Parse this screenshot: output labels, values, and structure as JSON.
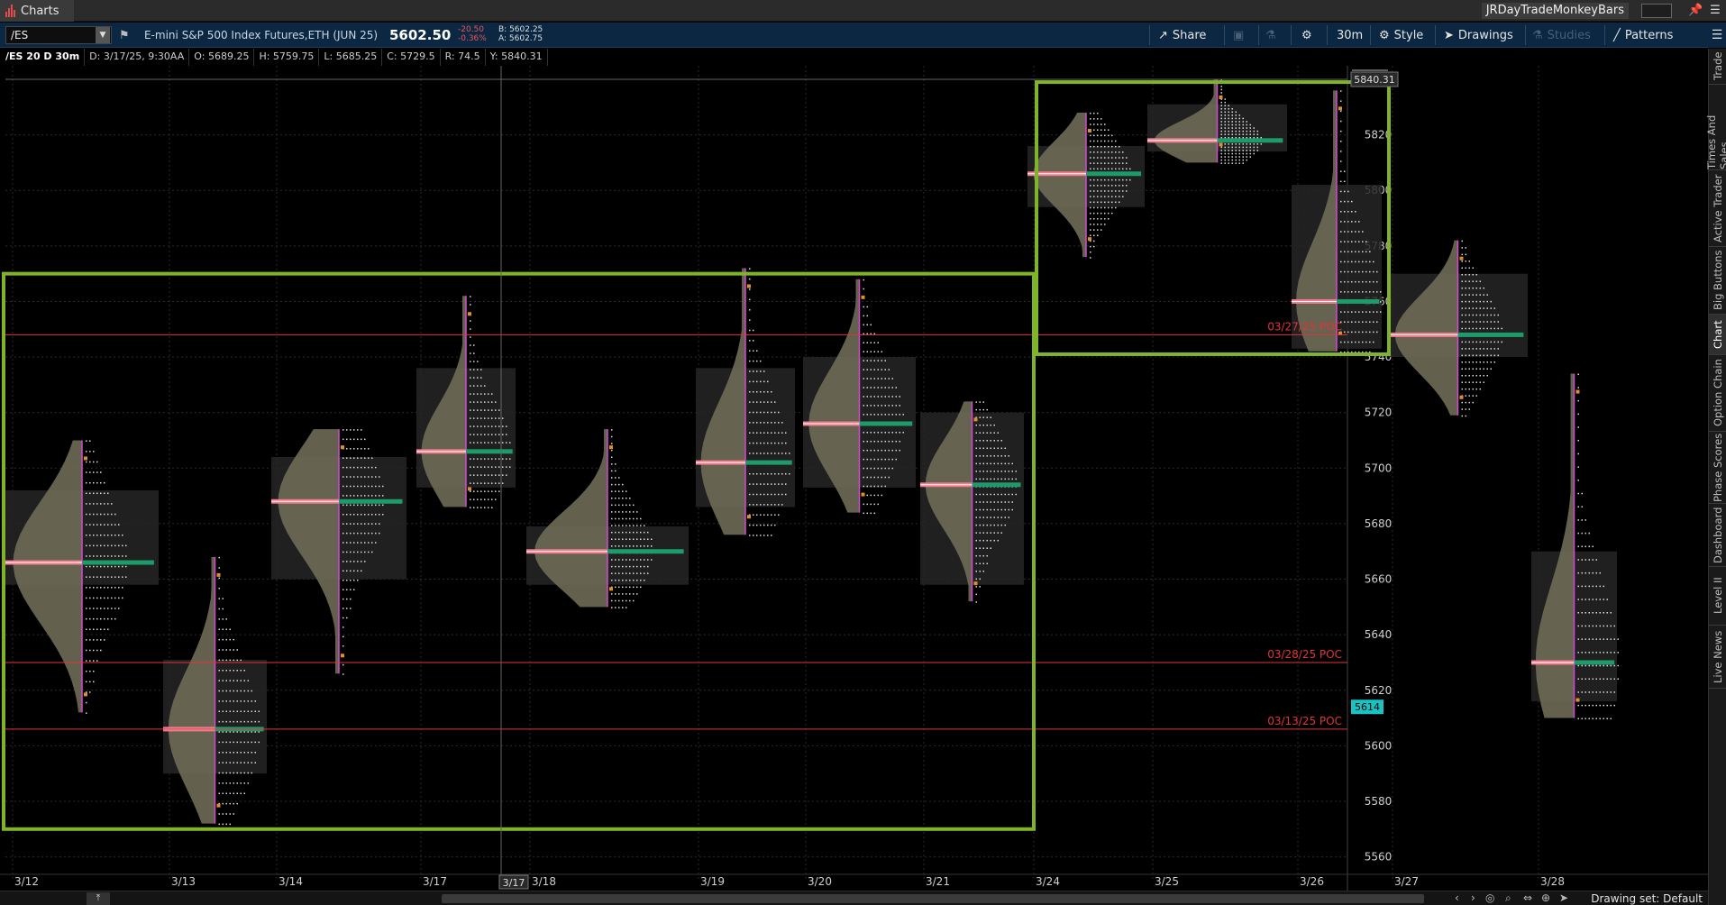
{
  "window": {
    "app_tab": "Charts",
    "workspace": "JRDayTradeMonkeyBars",
    "pin_icon": "pin-icon",
    "menu_icon": "hamburger-icon"
  },
  "symbol": {
    "input": "/ES",
    "description": "E-mini S&P 500 Index Futures,ETH (JUN 25)",
    "last": "5602.50",
    "change": "-20.50",
    "change_pct": "-0.36%",
    "bid": "B: 5602.25",
    "ask": "A: 5602.75"
  },
  "toolbar": {
    "share": "Share",
    "timeframe": "30m",
    "style": "Style",
    "drawings": "Drawings",
    "studies": "Studies",
    "patterns": "Patterns"
  },
  "info": {
    "sym": "/ES 20 D 30m",
    "date": "D: 3/17/25, 9:30AA",
    "open": "O: 5689.25",
    "high": "H: 5759.75",
    "low": "L: 5685.25",
    "close": "C: 5729.5",
    "range": "R: 74.5",
    "y": "Y: 5840.31"
  },
  "side_tabs": [
    "Trade",
    "Times And Sales",
    "Active Trader",
    "Big Buttons",
    "Chart",
    "Option Chain",
    "Phase Scores",
    "Dashboard",
    "Level II",
    "Live News"
  ],
  "chart_data": {
    "type": "market-profile",
    "price_axis": {
      "ticks": [
        5560,
        5580,
        5600,
        5620,
        5640,
        5660,
        5680,
        5700,
        5720,
        5740,
        5760,
        5780,
        5800,
        5820
      ],
      "ylim": [
        5556,
        5880
      ],
      "crosshair_label": "5840.31",
      "last_price_label": "5614"
    },
    "date_axis": {
      "labels": [
        "3/12",
        "3/13",
        "3/14",
        "3/17",
        "3/18",
        "3/19",
        "3/20",
        "3/21",
        "3/24",
        "3/25",
        "3/26",
        "3/27",
        "3/28"
      ],
      "crosshair_label": "3/17"
    },
    "poc_lines": [
      {
        "label": "03/27/25  POC",
        "price": 5748
      },
      {
        "label": "03/28/25  POC",
        "price": 5630
      },
      {
        "label": "03/13/25  POC",
        "price": 5606
      }
    ],
    "profiles": [
      {
        "day": "3/12",
        "poc": 5666,
        "high": 5710,
        "low": 5612,
        "vah": 5692,
        "val": 5658
      },
      {
        "day": "3/13",
        "poc": 5606,
        "high": 5668,
        "low": 5572,
        "vah": 5631,
        "val": 5590
      },
      {
        "day": "3/14",
        "poc": 5688,
        "high": 5714,
        "low": 5626,
        "vah": 5704,
        "val": 5660
      },
      {
        "day": "3/17",
        "poc": 5706,
        "high": 5762,
        "low": 5686,
        "vah": 5736,
        "val": 5693
      },
      {
        "day": "3/18",
        "poc": 5670,
        "high": 5714,
        "low": 5650,
        "vah": 5679,
        "val": 5658
      },
      {
        "day": "3/19",
        "poc": 5702,
        "high": 5772,
        "low": 5676,
        "vah": 5736,
        "val": 5686
      },
      {
        "day": "3/20",
        "poc": 5716,
        "high": 5768,
        "low": 5684,
        "vah": 5740,
        "val": 5693
      },
      {
        "day": "3/21",
        "poc": 5694,
        "high": 5724,
        "low": 5652,
        "vah": 5720,
        "val": 5658
      },
      {
        "day": "3/24",
        "poc": 5806,
        "high": 5828,
        "low": 5776,
        "vah": 5816,
        "val": 5794
      },
      {
        "day": "3/25",
        "poc": 5818,
        "high": 5840,
        "low": 5810,
        "vah": 5831,
        "val": 5814
      },
      {
        "day": "3/26",
        "poc": 5760,
        "high": 5836,
        "low": 5742,
        "vah": 5802,
        "val": 5743
      },
      {
        "day": "3/27",
        "poc": 5748,
        "high": 5782,
        "low": 5719,
        "vah": 5770,
        "val": 5740
      },
      {
        "day": "3/28",
        "poc": 5630,
        "high": 5734,
        "low": 5610,
        "vah": 5670,
        "val": 5616
      }
    ],
    "balance_boxes": [
      {
        "from": "3/12",
        "to": "3/21",
        "high": 5770,
        "low": 5570
      },
      {
        "from": "3/24",
        "to": "3/26",
        "high": 5839,
        "low": 5741
      }
    ]
  },
  "footer": {
    "drawing_set": "Drawing set: Default"
  },
  "colors": {
    "poc_line": "#e0343a",
    "box": "#7fb32a",
    "profile_fill": "#6e6a55",
    "value_area": "#262626",
    "grid": "#2a2a2a"
  }
}
